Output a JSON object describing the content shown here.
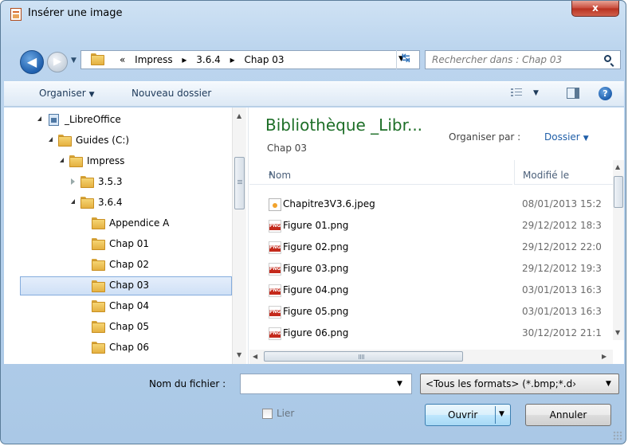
{
  "window": {
    "title": "Insérer une image",
    "close_label": "x"
  },
  "nav": {
    "back_icon": "arrow-left-icon",
    "forward_icon": "arrow-right-icon",
    "breadcrumb_prefix": "«",
    "breadcrumb": [
      "Impress",
      "3.6.4",
      "Chap 03"
    ],
    "breadcrumb_separator": "▸",
    "refresh_icon": "refresh-icon",
    "search_placeholder": "Rechercher dans : Chap 03"
  },
  "toolbar": {
    "organize_label": "Organiser",
    "new_folder_label": "Nouveau dossier",
    "view_icon": "details-view-icon",
    "preview_pane_icon": "preview-pane-icon",
    "help_icon": "help-icon"
  },
  "tree": {
    "items": [
      {
        "label": "_LibreOffice",
        "icon": "library-icon"
      },
      {
        "label": "Guides (C:)",
        "icon": "folder-icon"
      },
      {
        "label": "Impress",
        "icon": "folder-icon"
      },
      {
        "label": "3.5.3",
        "icon": "folder-icon"
      },
      {
        "label": "3.6.4",
        "icon": "folder-icon"
      },
      {
        "label": "Appendice A",
        "icon": "folder-icon"
      },
      {
        "label": "Chap 01",
        "icon": "folder-icon"
      },
      {
        "label": "Chap 02",
        "icon": "folder-icon"
      },
      {
        "label": "Chap 03",
        "icon": "folder-icon",
        "selected": true
      },
      {
        "label": "Chap 04",
        "icon": "folder-icon"
      },
      {
        "label": "Chap 05",
        "icon": "folder-icon"
      },
      {
        "label": "Chap 06",
        "icon": "folder-icon"
      }
    ]
  },
  "library": {
    "title": "Bibliothèque _Libr...",
    "subtitle": "Chap 03",
    "arrange_label": "Organiser par :",
    "arrange_value": "Dossier"
  },
  "columns": {
    "name": "Nom",
    "modified": "Modifié le"
  },
  "files": [
    {
      "name": "Chapitre3V3.6.jpeg",
      "date": "08/01/2013 15:2",
      "type": "jpeg"
    },
    {
      "name": "Figure 01.png",
      "date": "29/12/2012 18:3",
      "type": "png"
    },
    {
      "name": "Figure 02.png",
      "date": "29/12/2012 22:0",
      "type": "png"
    },
    {
      "name": "Figure 03.png",
      "date": "29/12/2012 19:3",
      "type": "png"
    },
    {
      "name": "Figure 04.png",
      "date": "03/01/2013 16:3",
      "type": "png"
    },
    {
      "name": "Figure 05.png",
      "date": "03/01/2013 16:3",
      "type": "png"
    },
    {
      "name": "Figure 06.png",
      "date": "30/12/2012 21:1",
      "type": "png"
    }
  ],
  "footer": {
    "filename_label": "Nom du fichier :",
    "filename_value": "",
    "format_value": "<Tous les formats> (*.bmp;*.d›",
    "link_label": "Lier",
    "link_checked": false,
    "open_label": "Ouvrir",
    "cancel_label": "Annuler"
  }
}
